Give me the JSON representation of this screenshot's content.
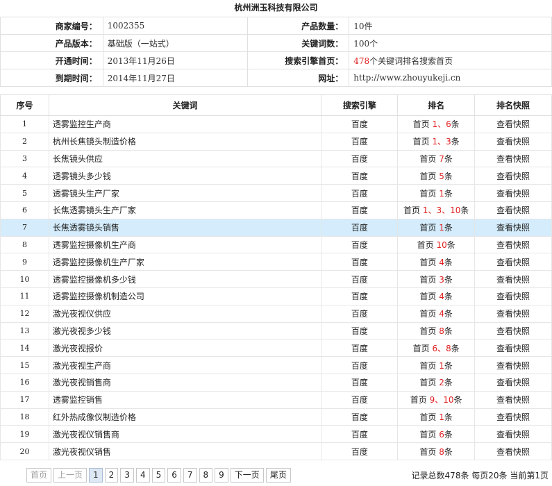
{
  "title": "杭州洲玉科技有限公司",
  "info": {
    "merchant_id_label": "商家编号：",
    "merchant_id": "1002355",
    "product_qty_label": "产品数量：",
    "product_qty": "10件",
    "version_label": "产品版本：",
    "version": "基础版（一站式）",
    "keywords_label": "关键词数：",
    "keywords": "100个",
    "open_label": "开通时间：",
    "open_date": "2013年11月26日",
    "se_label": "搜索引擎首页：",
    "se_count": "478",
    "se_text": "个关键词排名搜索首页",
    "expire_label": "到期时间：",
    "expire_date": "2014年11月27日",
    "url_label": "网址：",
    "url": "http://www.zhouyukeji.cn"
  },
  "table": {
    "headers": [
      "序号",
      "关键词",
      "搜索引擎",
      "排名",
      "排名快照"
    ],
    "rows": [
      {
        "no": "1",
        "keyword": "透雾监控生产商",
        "engine": "百度",
        "rank_pre": "首页",
        "rank_val": "1、6",
        "rank_suf": "条",
        "snap": "查看快照"
      },
      {
        "no": "2",
        "keyword": "杭州长焦镜头制造价格",
        "engine": "百度",
        "rank_pre": "首页",
        "rank_val": "1、3",
        "rank_suf": "条",
        "snap": "查看快照"
      },
      {
        "no": "3",
        "keyword": "长焦镜头供应",
        "engine": "百度",
        "rank_pre": "首页",
        "rank_val": "7",
        "rank_suf": "条",
        "snap": "查看快照"
      },
      {
        "no": "4",
        "keyword": "透雾镜头多少钱",
        "engine": "百度",
        "rank_pre": "首页",
        "rank_val": "5",
        "rank_suf": "条",
        "snap": "查看快照"
      },
      {
        "no": "5",
        "keyword": "透雾镜头生产厂家",
        "engine": "百度",
        "rank_pre": "首页",
        "rank_val": "1",
        "rank_suf": "条",
        "snap": "查看快照"
      },
      {
        "no": "6",
        "keyword": "长焦透雾镜头生产厂家",
        "engine": "百度",
        "rank_pre": "首页",
        "rank_val": "1、3、10",
        "rank_suf": "条",
        "snap": "查看快照"
      },
      {
        "no": "7",
        "keyword": "长焦透雾镜头销售",
        "engine": "百度",
        "rank_pre": "首页",
        "rank_val": "1",
        "rank_suf": "条",
        "snap": "查看快照"
      },
      {
        "no": "8",
        "keyword": "透雾监控摄像机生产商",
        "engine": "百度",
        "rank_pre": "首页",
        "rank_val": "10",
        "rank_suf": "条",
        "snap": "查看快照"
      },
      {
        "no": "9",
        "keyword": "透雾监控摄像机生产厂家",
        "engine": "百度",
        "rank_pre": "首页",
        "rank_val": "4",
        "rank_suf": "条",
        "snap": "查看快照"
      },
      {
        "no": "10",
        "keyword": "透雾监控摄像机多少钱",
        "engine": "百度",
        "rank_pre": "首页",
        "rank_val": "3",
        "rank_suf": "条",
        "snap": "查看快照"
      },
      {
        "no": "11",
        "keyword": "透雾监控摄像机制造公司",
        "engine": "百度",
        "rank_pre": "首页",
        "rank_val": "4",
        "rank_suf": "条",
        "snap": "查看快照"
      },
      {
        "no": "12",
        "keyword": "激光夜视仪供应",
        "engine": "百度",
        "rank_pre": "首页",
        "rank_val": "4",
        "rank_suf": "条",
        "snap": "查看快照"
      },
      {
        "no": "13",
        "keyword": "激光夜视多少钱",
        "engine": "百度",
        "rank_pre": "首页",
        "rank_val": "8",
        "rank_suf": "条",
        "snap": "查看快照"
      },
      {
        "no": "14",
        "keyword": "激光夜视报价",
        "engine": "百度",
        "rank_pre": "首页",
        "rank_val": "6、8",
        "rank_suf": "条",
        "snap": "查看快照"
      },
      {
        "no": "15",
        "keyword": "激光夜视生产商",
        "engine": "百度",
        "rank_pre": "首页",
        "rank_val": "1",
        "rank_suf": "条",
        "snap": "查看快照"
      },
      {
        "no": "16",
        "keyword": "激光夜视销售商",
        "engine": "百度",
        "rank_pre": "首页",
        "rank_val": "2",
        "rank_suf": "条",
        "snap": "查看快照"
      },
      {
        "no": "17",
        "keyword": "透雾监控销售",
        "engine": "百度",
        "rank_pre": "首页",
        "rank_val": "9、10",
        "rank_suf": "条",
        "snap": "查看快照"
      },
      {
        "no": "18",
        "keyword": "红外热成像仪制造价格",
        "engine": "百度",
        "rank_pre": "首页",
        "rank_val": "1",
        "rank_suf": "条",
        "snap": "查看快照"
      },
      {
        "no": "19",
        "keyword": "激光夜视仪销售商",
        "engine": "百度",
        "rank_pre": "首页",
        "rank_val": "6",
        "rank_suf": "条",
        "snap": "查看快照"
      },
      {
        "no": "20",
        "keyword": "激光夜视仪销售",
        "engine": "百度",
        "rank_pre": "首页",
        "rank_val": "8",
        "rank_suf": "条",
        "snap": "查看快照"
      }
    ],
    "highlighted_row": "7"
  },
  "pager": {
    "first": "首页",
    "prev": "上一页",
    "pages": [
      "1",
      "2",
      "3",
      "4",
      "5",
      "6",
      "7",
      "8",
      "9"
    ],
    "current": "1",
    "next": "下一页",
    "last": "尾页",
    "summary": "记录总数478条 每页20条 当前第1页"
  },
  "colors": {
    "rank_highlight": "#e02020",
    "row_highlight": "#d4ecfb"
  }
}
